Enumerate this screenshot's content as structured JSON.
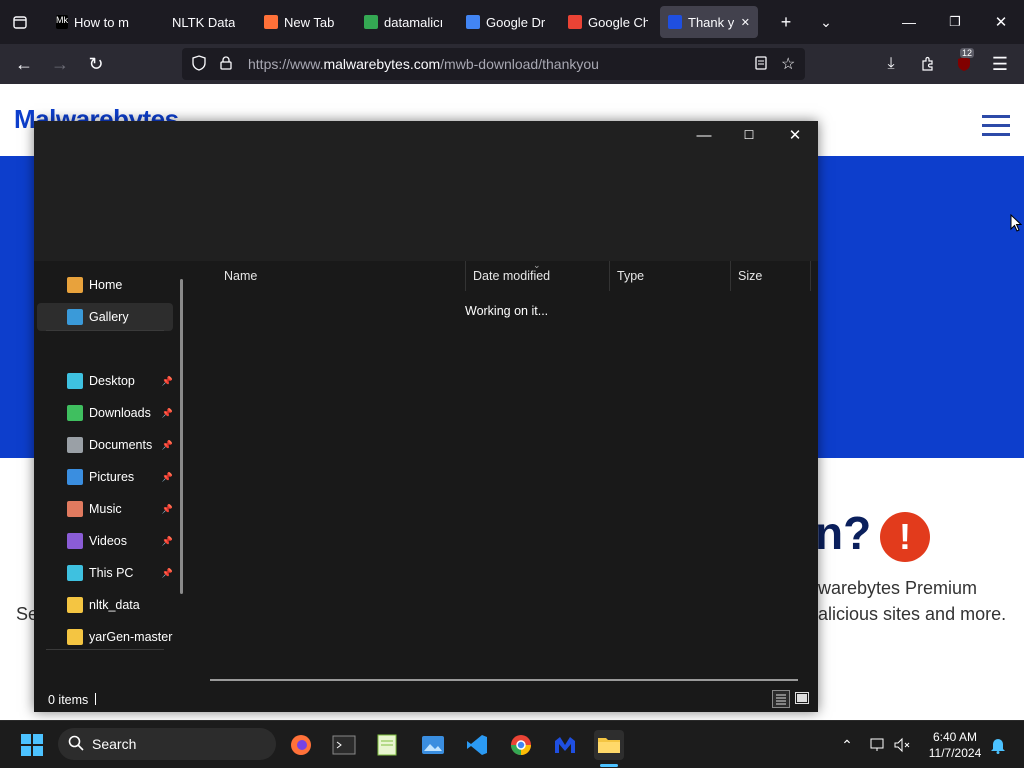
{
  "browser": {
    "tabs": [
      {
        "label": "How to m",
        "fav_color": "#000000",
        "fav_text": "Mk"
      },
      {
        "label": "NLTK Data",
        "fav_color": "",
        "fav_text": ""
      },
      {
        "label": "New Tab",
        "fav_color": "#ff7139",
        "fav_text": ""
      },
      {
        "label": "datamalicı",
        "fav_color": "#34a853",
        "fav_text": ""
      },
      {
        "label": "Google Dr",
        "fav_color": "#4285f4",
        "fav_text": ""
      },
      {
        "label": "Google Ch",
        "fav_color": "#ea4335",
        "fav_text": ""
      },
      {
        "label": "Thank y",
        "fav_color": "#1f4fe0",
        "fav_text": ""
      }
    ],
    "url_prefix": "https://www.",
    "url_domain": "malwarebytes.com",
    "url_path": "/mwb-download/thankyou",
    "notification_badge": "12"
  },
  "page": {
    "logo_text": "Malwarebytes",
    "heading_partial": "n?",
    "warn_glyph": "!",
    "promo_line1": "warebytes Premium",
    "promo_line2": "alicious sites and more.",
    "left_fragment": "Se"
  },
  "explorer": {
    "nav_items": [
      {
        "label": "Home",
        "icon": "home-icon",
        "color": "#e8a23c",
        "pinned": false
      },
      {
        "label": "Gallery",
        "icon": "gallery-icon",
        "color": "#3a9ad9",
        "pinned": false,
        "selected": true
      },
      {
        "label": "Desktop",
        "icon": "desktop-icon",
        "color": "#3ec1e0",
        "pinned": true
      },
      {
        "label": "Downloads",
        "icon": "download-icon",
        "color": "#3fbf5f",
        "pinned": true
      },
      {
        "label": "Documents",
        "icon": "documents-icon",
        "color": "#9aa0a6",
        "pinned": true
      },
      {
        "label": "Pictures",
        "icon": "pictures-icon",
        "color": "#3a8ee0",
        "pinned": true
      },
      {
        "label": "Music",
        "icon": "music-icon",
        "color": "#e07a5f",
        "pinned": true
      },
      {
        "label": "Videos",
        "icon": "videos-icon",
        "color": "#8a5cd6",
        "pinned": true
      },
      {
        "label": "This PC",
        "icon": "computer-icon",
        "color": "#3ec1e0",
        "pinned": true
      },
      {
        "label": "nltk_data",
        "icon": "folder-icon",
        "color": "#f4c542",
        "pinned": false
      },
      {
        "label": "yarGen-master",
        "icon": "folder-icon",
        "color": "#f4c542",
        "pinned": false
      }
    ],
    "columns": [
      "Name",
      "Date modified",
      "Type",
      "Size"
    ],
    "working_text": "Working on it...",
    "status_text": "0 items"
  },
  "taskbar": {
    "search_placeholder": "Search",
    "time": "6:40 AM",
    "date": "11/7/2024"
  }
}
